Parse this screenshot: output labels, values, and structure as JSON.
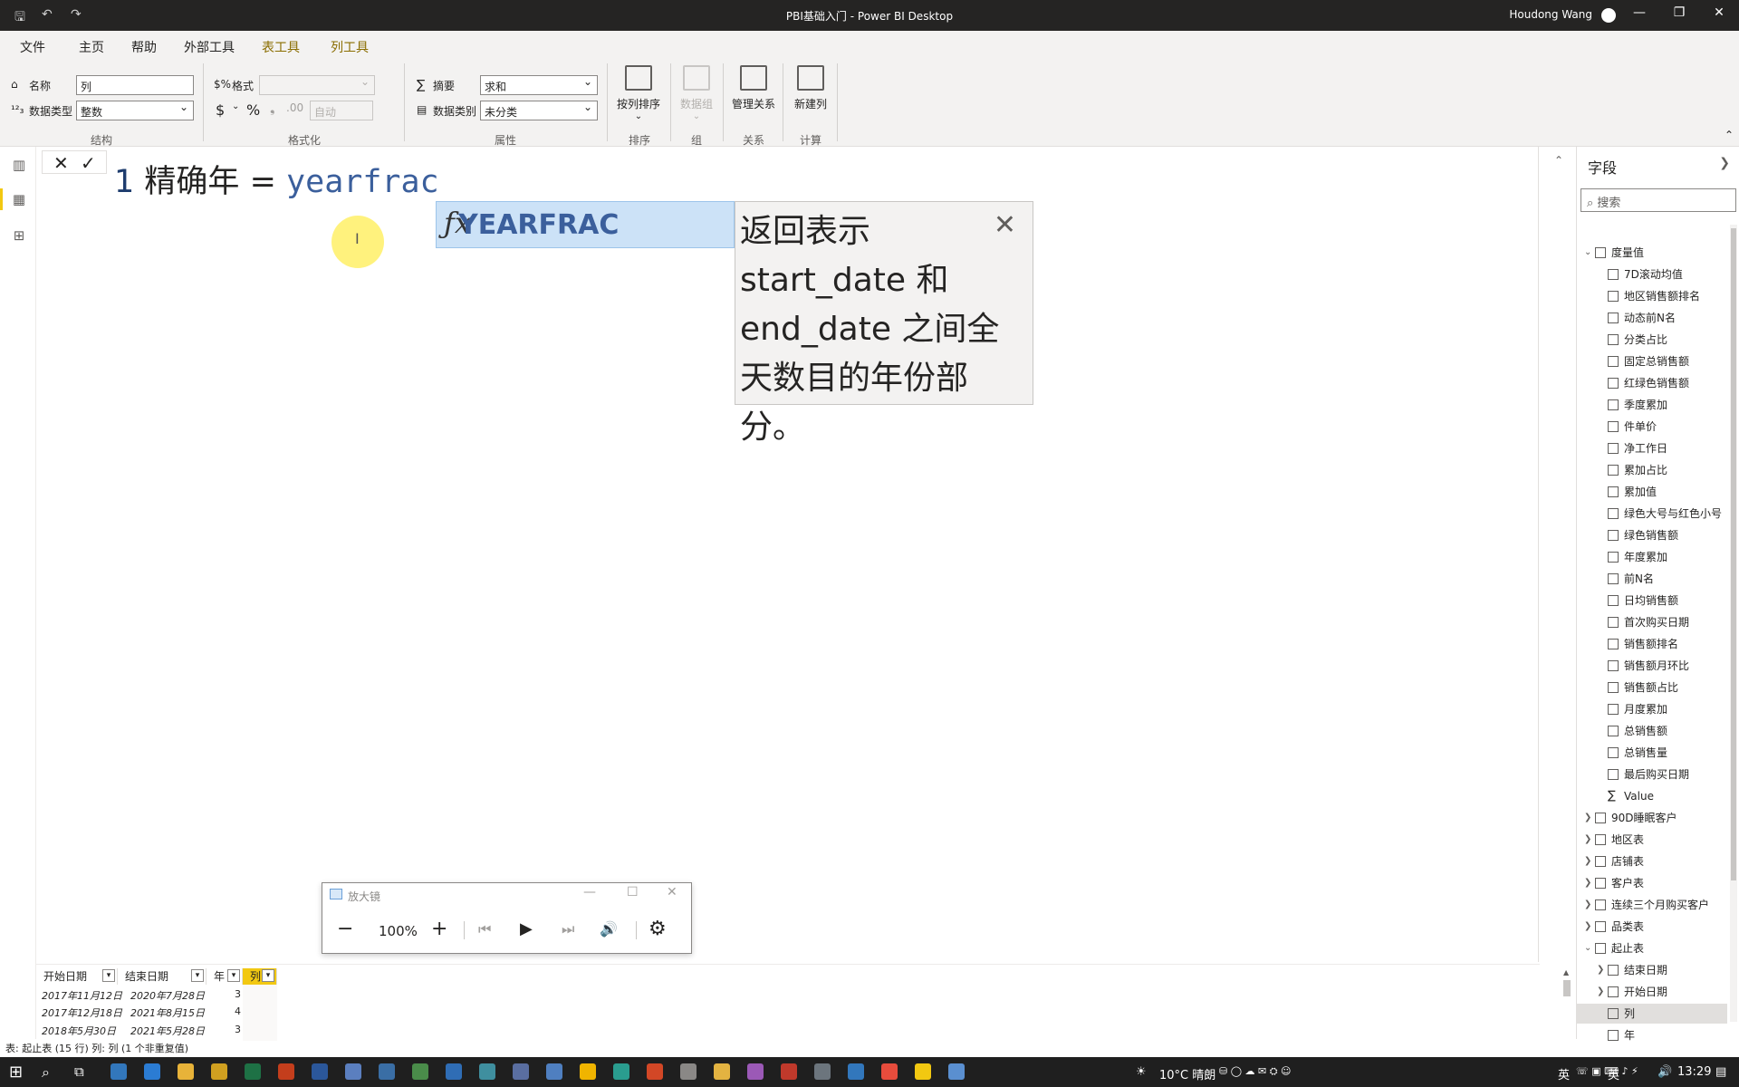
{
  "window": {
    "title": "PBI基础入门 - Power BI Desktop",
    "user": "Houdong Wang",
    "minimize": "—",
    "restore": "❐",
    "close": "✕"
  },
  "menu": {
    "tabs": [
      "文件",
      "主页",
      "帮助",
      "外部工具",
      "表工具",
      "列工具"
    ],
    "active_tab": "列工具"
  },
  "ribbon": {
    "structure": {
      "name_label": "名称",
      "name_value": "列",
      "datatype_label": "数据类型",
      "datatype_value": "整数",
      "group": "结构"
    },
    "formatting": {
      "format_label": "格式",
      "format_value": "",
      "currency": "$",
      "percent": "%",
      "comma": "❟",
      "decimals_placeholder": "自动",
      "group": "格式化"
    },
    "properties": {
      "summary_label": "摘要",
      "summary_value": "求和",
      "category_label": "数据类别",
      "category_value": "未分类",
      "group": "属性"
    },
    "sort": {
      "button": "按列排序",
      "group": "排序"
    },
    "groups": {
      "button": "数据组",
      "group": "组"
    },
    "relations": {
      "button": "管理关系",
      "group": "关系"
    },
    "calc": {
      "button": "新建列",
      "group": "计算"
    }
  },
  "formula": {
    "cancel": "✕",
    "commit": "✓",
    "line_number": "1",
    "name": "精确年",
    "operator": "=",
    "expression": "yearfrac"
  },
  "autocomplete": {
    "function_name": "YEARFRAC",
    "tooltip": "返回表示 start_date 和 end_date 之间全天数目的年份部分。",
    "close": "✕"
  },
  "magnifier": {
    "title": "放大镜",
    "zoom": "100%",
    "minimize": "—",
    "maximize": "☐",
    "close": "✕"
  },
  "table": {
    "columns": [
      "开始日期",
      "结束日期",
      "年",
      "列"
    ],
    "rows": [
      [
        "2017年11月12日",
        "2020年7月28日",
        "3"
      ],
      [
        "2017年12月18日",
        "2021年8月15日",
        "4"
      ],
      [
        "2018年5月30日",
        "2021年5月28日",
        "3"
      ]
    ]
  },
  "status": "表: 起止表 (15 行) 列: 列 (1 个非重复值)",
  "fields": {
    "title": "字段",
    "search_placeholder": "搜索",
    "measure_table": "度量值",
    "measures": [
      "7D滚动均值",
      "地区销售额排名",
      "动态前N名",
      "分类占比",
      "固定总销售额",
      "红绿色销售额",
      "季度累加",
      "件单价",
      "净工作日",
      "累加占比",
      "累加值",
      "绿色大号与红色小号",
      "绿色销售额",
      "年度累加",
      "前N名",
      "日均销售额",
      "首次购买日期",
      "销售额排名",
      "销售额月环比",
      "销售额占比",
      "月度累加",
      "总销售额",
      "总销售量",
      "最后购买日期"
    ],
    "value_field": "Value",
    "tables": [
      "90D睡眠客户",
      "地区表",
      "店铺表",
      "客户表",
      "连续三个月购买客户",
      "品类表",
      "起止表"
    ],
    "expanded_table_fields": [
      "结束日期",
      "开始日期",
      "列",
      "年"
    ],
    "selected_field": "列"
  },
  "taskbar": {
    "weather": "10°C 晴朗",
    "ime": "英",
    "lang": "英",
    "time": "13:29"
  },
  "colors": {
    "accent": "#f2c811",
    "titlebar": "#252423",
    "ribbon": "#f3f2f1",
    "formula_func": "#3b5f9c",
    "ac_highlight": "#cce2f7"
  }
}
